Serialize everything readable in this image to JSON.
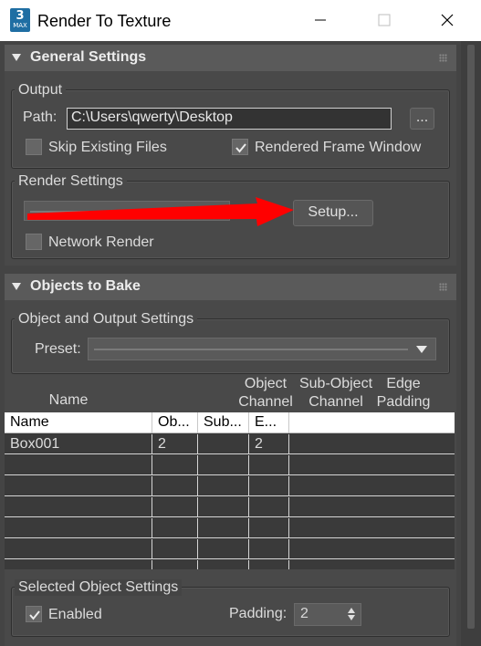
{
  "window": {
    "title": "Render To Texture",
    "icon_number": "3",
    "icon_caption": "MAX"
  },
  "general_settings": {
    "header": "General Settings",
    "output_group": "Output",
    "path_label": "Path:",
    "path_value": "C:\\Users\\qwerty\\Desktop",
    "browse_label": "...",
    "skip_existing_label": "Skip Existing Files",
    "skip_existing_checked": false,
    "rendered_frame_label": "Rendered Frame Window",
    "rendered_frame_checked": true,
    "render_settings_group": "Render Settings",
    "setup_label": "Setup...",
    "network_render_label": "Network Render",
    "network_render_checked": false
  },
  "objects_to_bake": {
    "header": "Objects to Bake",
    "group": "Object and Output Settings",
    "preset_label": "Preset:",
    "column_headers": {
      "name": "Name",
      "object_channel": [
        "Object",
        "Channel"
      ],
      "subobject_channel": [
        "Sub-Object",
        "Channel"
      ],
      "edge_padding": [
        "Edge",
        "Padding"
      ]
    },
    "table": {
      "columns": [
        "Name",
        "Ob...",
        "Sub...",
        "E..."
      ],
      "rows": [
        {
          "name": "Box001",
          "object_channel": "2",
          "subobject_channel": "",
          "edge_padding": "2"
        }
      ]
    },
    "selected_group": "Selected Object Settings",
    "enabled_label": "Enabled",
    "enabled_checked": true,
    "padding_label": "Padding:",
    "padding_value": "2"
  },
  "colors": {
    "background": "#444444",
    "annotation_arrow": "#ff0000"
  }
}
